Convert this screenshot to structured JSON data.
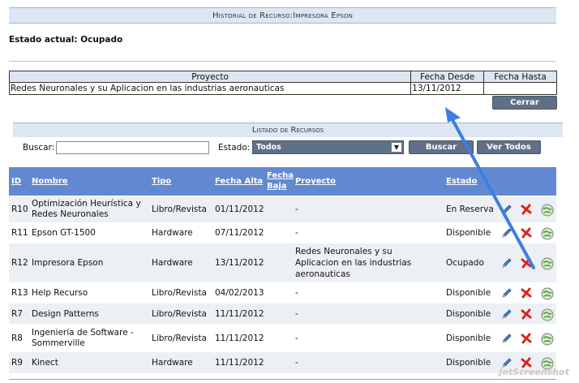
{
  "historial": {
    "title": "Historial de Recurso:Impresora Epson",
    "estado_actual": "Estado actual: Ocupado",
    "columns": [
      "Proyecto",
      "Fecha Desde",
      "Fecha Hasta"
    ],
    "rows": [
      {
        "proyecto": "Redes Neuronales y su Aplicacion en las industrias aeronauticas",
        "desde": "13/11/2012",
        "hasta": ""
      }
    ],
    "cerrar_label": "Cerrar"
  },
  "listado": {
    "title": "Listado de Recursos",
    "buscar_label": "Buscar:",
    "buscar_value": "",
    "estado_label": "Estado:",
    "estado_selected": "Todos",
    "buscar_button": "Buscar",
    "ver_todos_button": "Ver Todos",
    "columns": {
      "id": "ID",
      "nombre": "Nombre",
      "tipo": "Tipo",
      "fecha_alta": "Fecha Alta",
      "fecha_baja_1": "Fecha",
      "fecha_baja_2": "Baja",
      "proyecto": "Proyecto",
      "estado": "Estado"
    },
    "rows": [
      {
        "id": "R10",
        "nombre_1": "Optimización Heurística y",
        "nombre_2": "Redes Neuronales",
        "tipo": "Libro/Revista",
        "alta": "01/11/2012",
        "proyecto_1": "-",
        "proyecto_2": "",
        "proyecto_3": "",
        "estado": "En Reserva"
      },
      {
        "id": "R11",
        "nombre_1": "Epson GT-1500",
        "nombre_2": "",
        "tipo": "Hardware",
        "alta": "07/11/2012",
        "proyecto_1": "-",
        "proyecto_2": "",
        "proyecto_3": "",
        "estado": "Disponible"
      },
      {
        "id": "R12",
        "nombre_1": "Impresora Epson",
        "nombre_2": "",
        "tipo": "Hardware",
        "alta": "13/11/2012",
        "proyecto_1": "Redes Neuronales y su",
        "proyecto_2": "Aplicacion en las industrias",
        "proyecto_3": "aeronauticas",
        "estado": "Ocupado"
      },
      {
        "id": "R13",
        "nombre_1": "Help Recurso",
        "nombre_2": "",
        "tipo": "Libro/Revista",
        "alta": "04/02/2013",
        "proyecto_1": "-",
        "proyecto_2": "",
        "proyecto_3": "",
        "estado": "Disponible"
      },
      {
        "id": "R7",
        "nombre_1": "Design Patterns",
        "nombre_2": "",
        "tipo": "Libro/Revista",
        "alta": "11/11/2012",
        "proyecto_1": "-",
        "proyecto_2": "",
        "proyecto_3": "",
        "estado": "Disponible"
      },
      {
        "id": "R8",
        "nombre_1": "Ingeniería de Software -",
        "nombre_2": "Sommerville",
        "tipo": "Libro/Revista",
        "alta": "11/11/2012",
        "proyecto_1": "-",
        "proyecto_2": "",
        "proyecto_3": "",
        "estado": "Disponible"
      },
      {
        "id": "R9",
        "nombre_1": "Kinect",
        "nombre_2": "",
        "tipo": "Hardware",
        "alta": "11/11/2012",
        "proyecto_1": "-",
        "proyecto_2": "",
        "proyecto_3": "",
        "estado": "Disponible"
      }
    ]
  },
  "icons": {
    "edit": "pencil-icon",
    "delete": "delete-x-icon",
    "history": "history-globe-icon"
  },
  "colors": {
    "header_blue": "#6188d0",
    "button_gray": "#5e7186",
    "light_band": "#dde7f3",
    "annotation": "#3d7fe0"
  },
  "watermark": "JetScreenshot"
}
